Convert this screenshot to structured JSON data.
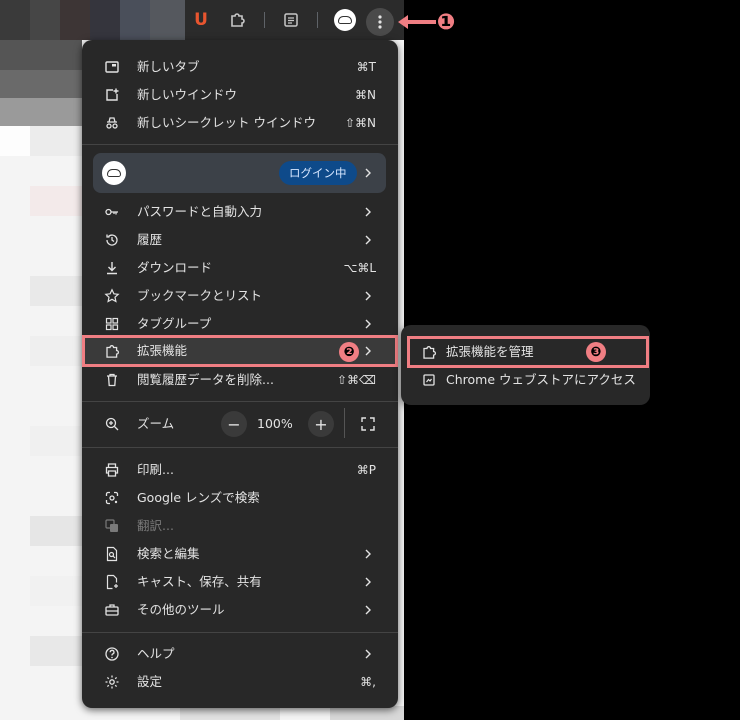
{
  "toolbar": {
    "icons": [
      "u-extension-icon",
      "puzzle-icon",
      "reading-list-icon",
      "profile-avatar-icon",
      "more-vert-icon"
    ],
    "extension_letter": "U"
  },
  "menu": {
    "items_top": [
      {
        "label": "新しいタブ",
        "shortcut": "⌘T",
        "icon": "new-tab-icon"
      },
      {
        "label": "新しいウインドウ",
        "shortcut": "⌘N",
        "icon": "new-window-icon"
      },
      {
        "label": "新しいシークレット ウインドウ",
        "shortcut": "⇧⌘N",
        "icon": "incognito-icon"
      }
    ],
    "profile": {
      "badge": "ログイン中"
    },
    "items_mid": [
      {
        "label": "パスワードと自動入力",
        "icon": "key-icon"
      },
      {
        "label": "履歴",
        "icon": "history-icon"
      },
      {
        "label": "ダウンロード",
        "shortcut": "⌥⌘L",
        "icon": "download-icon"
      },
      {
        "label": "ブックマークとリスト",
        "icon": "star-icon"
      },
      {
        "label": "タブグループ",
        "icon": "tab-group-icon"
      },
      {
        "label": "拡張機能",
        "icon": "puzzle-icon"
      },
      {
        "label": "閲覧履歴データを削除...",
        "shortcut": "⇧⌘⌫",
        "icon": "trash-icon"
      }
    ],
    "zoom": {
      "label": "ズーム",
      "minus": "−",
      "value": "100%",
      "plus": "+"
    },
    "items_tools": [
      {
        "label": "印刷...",
        "shortcut": "⌘P",
        "icon": "print-icon"
      },
      {
        "label": "Google レンズで検索",
        "icon": "lens-icon"
      },
      {
        "label": "翻訳...",
        "icon": "translate-icon",
        "disabled": true
      },
      {
        "label": "検索と編集",
        "icon": "search-edit-icon"
      },
      {
        "label": "キャスト、保存、共有",
        "icon": "cast-save-icon"
      },
      {
        "label": "その他のツール",
        "icon": "toolbox-icon"
      }
    ],
    "items_bottom": [
      {
        "label": "ヘルプ",
        "icon": "help-icon"
      },
      {
        "label": "設定",
        "shortcut": "⌘,",
        "icon": "settings-icon"
      }
    ]
  },
  "submenu": {
    "items": [
      {
        "label": "拡張機能を管理",
        "icon": "puzzle-icon"
      },
      {
        "label": "Chrome ウェブストアにアクセス",
        "icon": "web-store-icon"
      }
    ]
  },
  "annotations": {
    "step1": "❶",
    "step2": "❷",
    "step3": "❸"
  },
  "colors": {
    "menu_bg": "#282828",
    "highlight": "#f07e83",
    "badge_bg": "#0e4a8a"
  }
}
